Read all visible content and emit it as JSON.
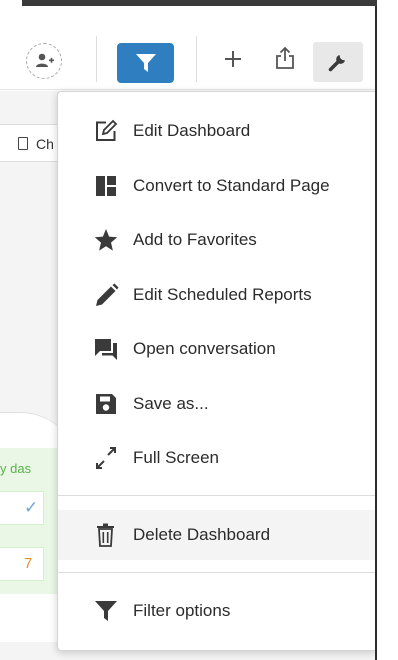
{
  "toolbar": {
    "icons": [
      "add-person-icon",
      "filter-icon",
      "plus-icon",
      "share-icon",
      "wrench-icon"
    ],
    "filter_button_color": "#2f7fc0"
  },
  "background": {
    "tab_label": "Ch",
    "card_label": "y das",
    "card_check": "✓",
    "card_number": "7",
    "card_label_color": "#5ab34a",
    "card_number_color": "#e5902a"
  },
  "menu": {
    "items": [
      {
        "label": "Edit Dashboard",
        "icon": "edit-icon"
      },
      {
        "label": "Convert to Standard Page",
        "icon": "layout-icon"
      },
      {
        "label": "Add to Favorites",
        "icon": "star-icon"
      },
      {
        "label": "Edit Scheduled Reports",
        "icon": "pencil-icon"
      },
      {
        "label": "Open conversation",
        "icon": "chat-icon"
      },
      {
        "label": "Save as...",
        "icon": "save-icon"
      },
      {
        "label": "Full Screen",
        "icon": "expand-icon"
      }
    ],
    "danger_items": [
      {
        "label": "Delete Dashboard",
        "icon": "trash-icon"
      }
    ],
    "footer_items": [
      {
        "label": "Filter options",
        "icon": "filter-icon"
      }
    ]
  }
}
